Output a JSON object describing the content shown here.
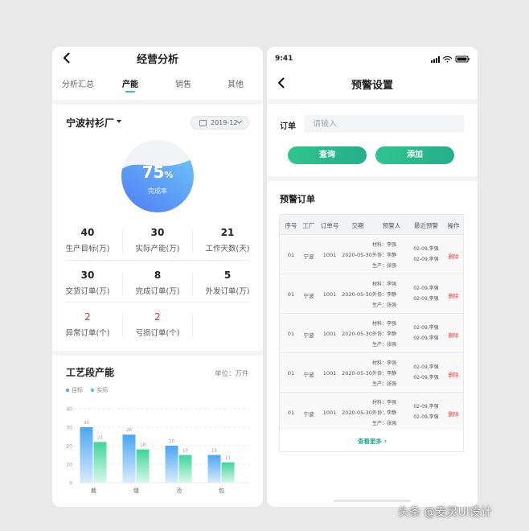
{
  "left": {
    "title": "经营分析",
    "tabs": [
      "分析汇总",
      "产能",
      "销售",
      "其他"
    ],
    "active_tab": 1,
    "factory": "宁波衬衫厂",
    "date": "2019-12",
    "gauge": {
      "value": "75",
      "unit": "%",
      "label": "完成率",
      "percent": 75
    },
    "stats": [
      {
        "value": "40",
        "label": "生产目标(万)"
      },
      {
        "value": "30",
        "label": "实际产能(万)"
      },
      {
        "value": "21",
        "label": "工作天数(天)"
      },
      {
        "value": "30",
        "label": "交货订单(万)"
      },
      {
        "value": "8",
        "label": "完成订单(万)"
      },
      {
        "value": "5",
        "label": "外发订单(万)"
      },
      {
        "value": "2",
        "label": "异常订单(个)",
        "alert": true
      },
      {
        "value": "2",
        "label": "亏损订单(个)",
        "alert": true
      }
    ],
    "process_title": "工艺段产能",
    "unit_label": "单位：万件"
  },
  "chart_data": {
    "type": "bar",
    "categories": [
      "裁",
      "缝",
      "汤",
      "包"
    ],
    "series": [
      {
        "name": "目标",
        "values": [
          30,
          26,
          20,
          15
        ],
        "color": "#4aa6f2"
      },
      {
        "name": "实际",
        "values": [
          22,
          18,
          15,
          11
        ],
        "color": "#3fd59a"
      }
    ],
    "yticks": [
      0,
      10,
      20,
      30,
      40
    ],
    "ylim": [
      0,
      40
    ],
    "legend": "top-left",
    "grid": true
  },
  "right": {
    "time": "9:41",
    "title": "预警设置",
    "order_label": "订单",
    "order_placeholder": "请输入",
    "query_button": "查询",
    "add_button": "添加",
    "section_title": "预警订单",
    "columns": [
      "序号",
      "工厂",
      "订单号",
      "交期",
      "预警人",
      "最近预警",
      "操作"
    ],
    "rows": [
      {
        "no": "01",
        "factory": "宁波",
        "order": "1001",
        "date": "2020-05-30",
        "people": [
          "材料：李强",
          "外协：李静",
          "生产：张强"
        ],
        "warns": [
          "02-09,李强",
          "02-09,李强"
        ],
        "action": "删除"
      },
      {
        "no": "01",
        "factory": "宁波",
        "order": "1001",
        "date": "2020-05-30",
        "people": [
          "材料：李强",
          "外协：李静",
          "生产：张强"
        ],
        "warns": [
          "02-09,李强",
          "02-09,李强"
        ],
        "action": "删除"
      },
      {
        "no": "01",
        "factory": "宁波",
        "order": "1001",
        "date": "2020-05-30",
        "people": [
          "材料：李强",
          "外协：李静",
          "生产：张强"
        ],
        "warns": [
          "02-09,李强",
          "02-09,李强"
        ],
        "action": "删除"
      },
      {
        "no": "01",
        "factory": "宁波",
        "order": "1001",
        "date": "2020-05-30",
        "people": [
          "材料：李强",
          "外协：李静",
          "生产：张强"
        ],
        "warns": [
          "02-09,李强",
          "02-09,李强"
        ],
        "action": "删除"
      },
      {
        "no": "01",
        "factory": "宁波",
        "order": "1001",
        "date": "2020-05-30",
        "people": [
          "材料：李强",
          "外协：李静",
          "生产：张强"
        ],
        "warns": [
          "02-09,李强",
          "02-09,李强"
        ],
        "action": "删除"
      }
    ],
    "more_label": "查看更多"
  },
  "watermark": "头条 @麦灵UI设计",
  "colors": {
    "accent": "#2ec59a",
    "alert": "#e83a3a",
    "gauge_start": "#4f7cf5",
    "gauge_end": "#63b6f7"
  }
}
